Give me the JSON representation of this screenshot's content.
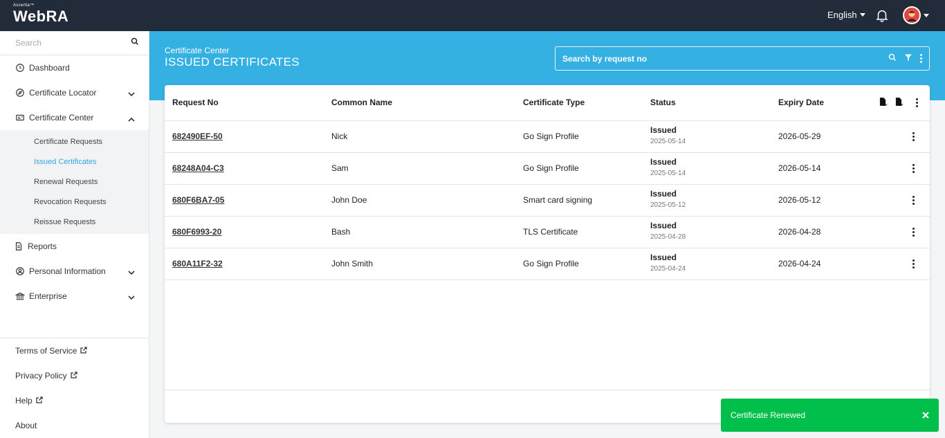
{
  "app": {
    "logo_small": "Ascertia™",
    "logo_big": "WebRA"
  },
  "topbar": {
    "language": "English"
  },
  "sidebar": {
    "search_placeholder": "Search",
    "items": [
      {
        "label": "Dashboard",
        "icon": "clock-icon"
      },
      {
        "label": "Certificate Locator",
        "icon": "compass-icon"
      },
      {
        "label": "Certificate Center",
        "icon": "id-card-icon"
      }
    ],
    "sub_items": [
      {
        "label": "Certificate Requests"
      },
      {
        "label": "Issued Certificates",
        "active": true
      },
      {
        "label": "Renewal Requests"
      },
      {
        "label": "Revocation Requests"
      },
      {
        "label": "Reissue Requests"
      }
    ],
    "items_after": [
      {
        "label": "Reports",
        "icon": "document-icon"
      },
      {
        "label": "Personal Information",
        "icon": "user-circle-icon"
      },
      {
        "label": "Enterprise",
        "icon": "bank-icon"
      }
    ],
    "footer": [
      {
        "label": "Terms of Service"
      },
      {
        "label": "Privacy Policy"
      },
      {
        "label": "Help"
      },
      {
        "label": "About"
      }
    ]
  },
  "header": {
    "breadcrumb": "Certificate Center",
    "title": "ISSUED CERTIFICATES",
    "search_placeholder": "Search by request no"
  },
  "table": {
    "columns": [
      "Request No",
      "Common Name",
      "Certificate Type",
      "Status",
      "Expiry Date"
    ],
    "rows": [
      {
        "request_no": "682490EF-50",
        "common_name": "Nick",
        "type": "Go Sign Profile",
        "status": "Issued",
        "status_date": "2025-05-14",
        "expiry": "2026-05-29"
      },
      {
        "request_no": "68248A04-C3",
        "common_name": "Sam",
        "type": "Go Sign Profile",
        "status": "Issued",
        "status_date": "2025-05-14",
        "expiry": "2026-05-14"
      },
      {
        "request_no": "680F6BA7-05",
        "common_name": "John Doe",
        "type": "Smart card signing",
        "status": "Issued",
        "status_date": "2025-05-12",
        "expiry": "2026-05-12"
      },
      {
        "request_no": "680F6993-20",
        "common_name": "Bash",
        "type": "TLS Certificate",
        "status": "Issued",
        "status_date": "2025-04-28",
        "expiry": "2026-04-28"
      },
      {
        "request_no": "680A11F2-32",
        "common_name": "John Smith",
        "type": "Go Sign Profile",
        "status": "Issued",
        "status_date": "2025-04-24",
        "expiry": "2026-04-24"
      }
    ],
    "export_csv": "CSV",
    "export_pdf": "PDF"
  },
  "toast": {
    "message": "Certificate Renewed"
  },
  "colors": {
    "topbar": "#222b3a",
    "accent": "#35b0e3",
    "active_link": "#2fa9dd",
    "toast": "#00c04b"
  }
}
